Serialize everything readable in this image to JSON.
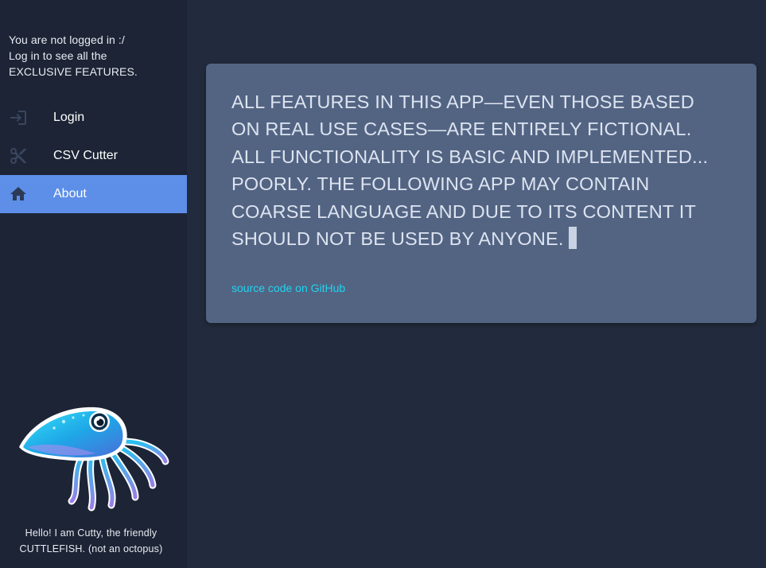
{
  "sidebar": {
    "login_notice": [
      "You are not logged in :/",
      "Log in to see all the",
      "EXCLUSIVE FEATURES."
    ],
    "nav": [
      {
        "label": "Login",
        "icon": "login-icon",
        "active": false
      },
      {
        "label": "CSV Cutter",
        "icon": "scissors-icon",
        "active": false
      },
      {
        "label": "About",
        "icon": "home-icon",
        "active": true
      }
    ],
    "mascot_caption": [
      "Hello! I am Cutty, the friendly",
      "CUTTLEFISH. (not an octopus)"
    ]
  },
  "main": {
    "disclaimer_lines": [
      "ALL FEATURES IN THIS APP—EVEN THOSE BASED",
      "ON REAL USE CASES—ARE ENTIRELY FICTIONAL.",
      "ALL FUNCTIONALITY IS BASIC AND IMPLEMENTED...",
      "POORLY. THE FOLLOWING APP MAY CONTAIN",
      "COARSE LANGUAGE AND DUE TO ITS CONTENT IT",
      "SHOULD NOT BE USED BY ANYONE."
    ],
    "source_link": "source code on GitHub"
  },
  "colors": {
    "background": "#222b3d",
    "sidebar": "#1c2435",
    "active_nav": "#5d8fe8",
    "card": "#536483",
    "link": "#22d3ee"
  }
}
